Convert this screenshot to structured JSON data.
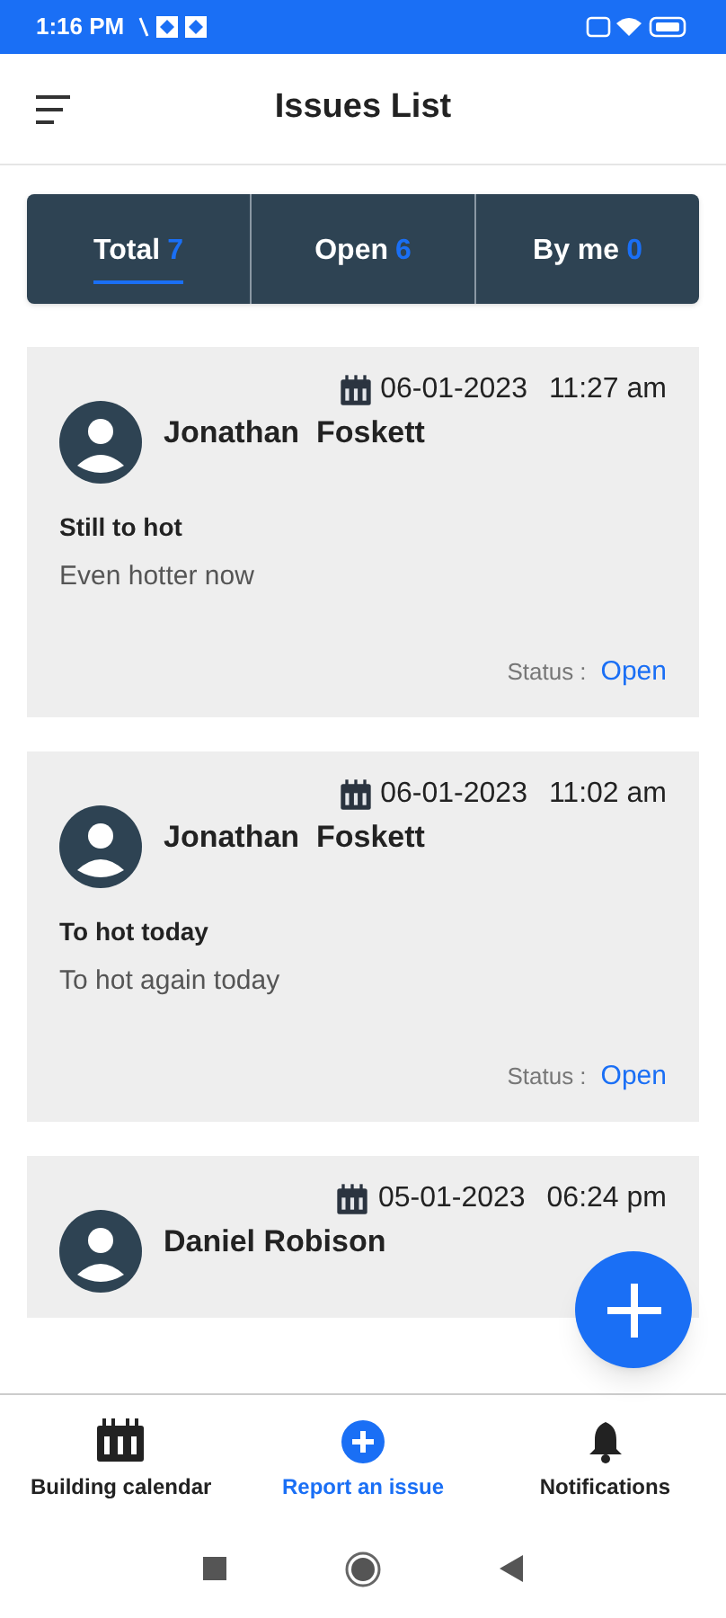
{
  "status_bar": {
    "time": "1:16 PM"
  },
  "header": {
    "title": "Issues List"
  },
  "tabs": [
    {
      "label": "Total",
      "count": "7",
      "selected": true
    },
    {
      "label": "Open",
      "count": "6",
      "selected": false
    },
    {
      "label": "By me",
      "count": "0",
      "selected": false
    }
  ],
  "issues": [
    {
      "date": "06-01-2023",
      "time": "11:27 am",
      "name": "Jonathan  Foskett",
      "title": "Still to hot",
      "description": "Even hotter now",
      "status_label": "Status :",
      "status": "Open"
    },
    {
      "date": "06-01-2023",
      "time": "11:02 am",
      "name": "Jonathan  Foskett",
      "title": "To hot today",
      "description": "To hot again today",
      "status_label": "Status :",
      "status": "Open"
    },
    {
      "date": "05-01-2023",
      "time": "06:24 pm",
      "name": "Daniel Robison"
    }
  ],
  "bottom_nav": [
    {
      "kind": "calendar",
      "label": "Building calendar",
      "selected": false
    },
    {
      "kind": "add",
      "label": "Report an issue",
      "selected": true
    },
    {
      "kind": "bell",
      "label": "Notifications",
      "selected": false
    }
  ]
}
